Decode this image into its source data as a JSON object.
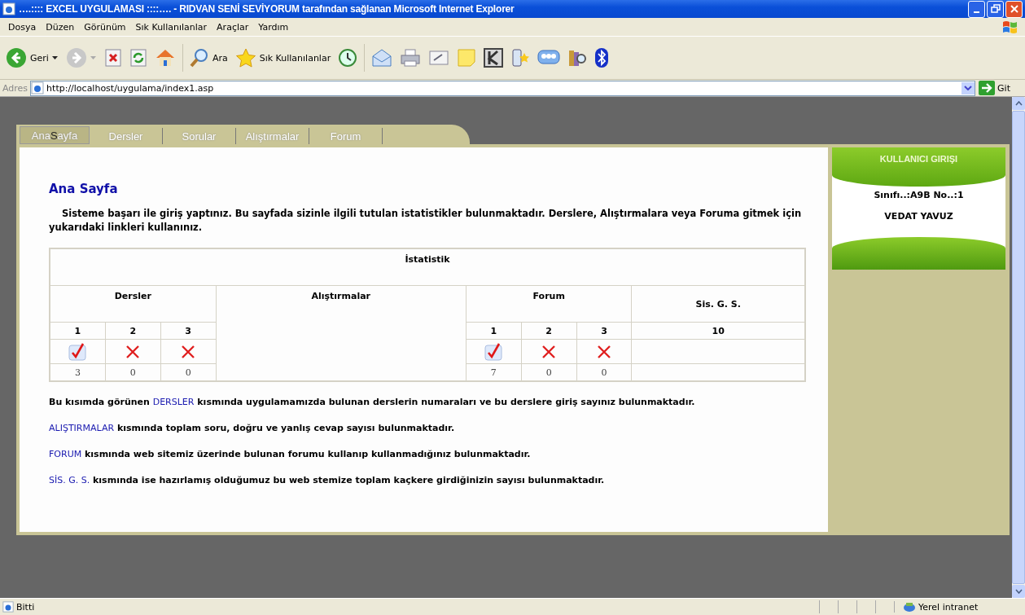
{
  "window": {
    "title": "….:::: EXCEL UYGULAMASI ::::…. - RIDVAN SENİ SEVİYORUM tarafından sağlanan Microsoft Internet Explorer"
  },
  "menu": [
    "Dosya",
    "Düzen",
    "Görünüm",
    "Sık Kullanılanlar",
    "Araçlar",
    "Yardım"
  ],
  "toolbar": [
    {
      "kind": "back",
      "label": "Geri"
    },
    {
      "kind": "forward"
    },
    {
      "kind": "stop"
    },
    {
      "kind": "refresh"
    },
    {
      "kind": "home"
    },
    {
      "kind": "search",
      "label": "Ara"
    },
    {
      "kind": "favorites",
      "label": "Sık Kullanılanlar"
    },
    {
      "kind": "history"
    },
    {
      "kind": "mail"
    },
    {
      "kind": "print"
    },
    {
      "kind": "edit"
    },
    {
      "kind": "note"
    },
    {
      "kind": "k"
    },
    {
      "kind": "phone"
    },
    {
      "kind": "messenger"
    },
    {
      "kind": "research"
    },
    {
      "kind": "bluetooth"
    }
  ],
  "address": {
    "label": "Adres",
    "value": "http://localhost/uygulama/index1.asp",
    "go": "Git"
  },
  "tabs": [
    {
      "label": "Ana**S**ayfa",
      "selected": true
    },
    {
      "label": "Dersler",
      "selected": false
    },
    {
      "label": "Sorular",
      "selected": false
    },
    {
      "label": "Alıştırmalar",
      "selected": false
    },
    {
      "label": "Forum",
      "selected": false
    }
  ],
  "heading": "Ana Sayfa",
  "intro": "Sisteme başarı ile giriş yaptınız. Bu sayfada sizinle ilgili tutulan istatistikler bulunmaktadır. Derslere, Alıştırmalara veya Foruma gitmek için yukarıdaki linkleri kullanınız.",
  "stats": {
    "title": "İstatistik",
    "headers": [
      "Dersler",
      "Alıştırmalar",
      "Forum",
      "Sis. G. S."
    ],
    "dersler": [
      {
        "no": "1",
        "done": true,
        "count": "3"
      },
      {
        "no": "2",
        "done": false,
        "count": "0"
      },
      {
        "no": "3",
        "done": false,
        "count": "0"
      }
    ],
    "forum": [
      {
        "no": "1",
        "done": true,
        "count": "7"
      },
      {
        "no": "2",
        "done": false,
        "count": "0"
      },
      {
        "no": "3",
        "done": false,
        "count": "0"
      }
    ],
    "sis": "10"
  },
  "notes": [
    {
      "before": "Bu kısımda görünen ",
      "highlight": "DERSLER",
      "after": " kısmında uygulamamızda bulunan derslerin numaraları ve bu derslere giriş sayınız bulunmaktadır."
    },
    {
      "highlight": "ALIŞTIRMALAR",
      "after": " kısmında toplam soru, doğru ve yanlış cevap sayısı bulunmaktadır."
    },
    {
      "highlight": "FORUM",
      "after": " kısmında web sitemiz üzerinde bulunan forumu kullanıp kullanmadığınız bulunmaktadır."
    },
    {
      "highlight": "SİS. G. S.",
      "after": " kısmında ise hazırlamış olduğumuz bu web stemize toplam kaçkere girdiğinizin sayısı bulunmaktadır."
    }
  ],
  "login": {
    "title": "KULLANICI GIRIŞI",
    "class_line": "Sınıfı..:A9B No..:1",
    "name": "VEDAT YAVUZ"
  },
  "status": {
    "text": "Bitti",
    "zone": "Yerel intranet"
  }
}
